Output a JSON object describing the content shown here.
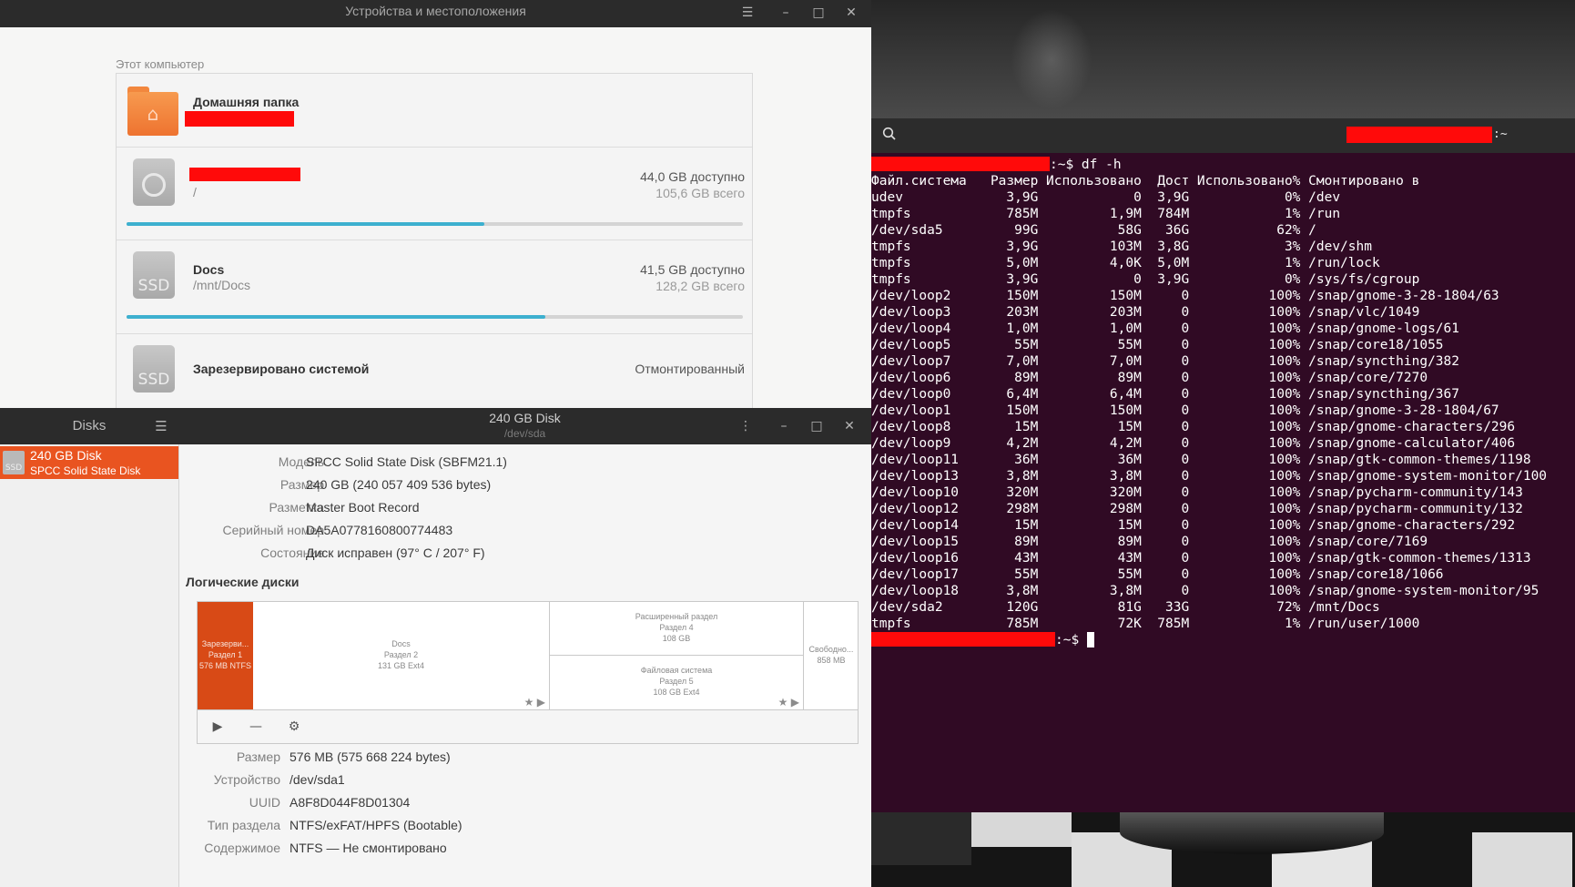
{
  "colors": {
    "accent": "#e95420",
    "usage_bar": "#3db0cf",
    "terminal_bg": "#300a24",
    "redaction": "#ff0a0a"
  },
  "files": {
    "title": "Устройства и местоположения",
    "menu_icon": "hamburger-icon",
    "section_label": "Этот компьютер",
    "places": [
      {
        "name": "Домашняя папка",
        "icon": "home-folder-icon"
      },
      {
        "path": "/",
        "available": "44,0 GB доступно",
        "total": "105,6 GB всего",
        "usage_fraction": 0.58,
        "icon": "disk-icon"
      },
      {
        "name": "Docs",
        "path": "/mnt/Docs",
        "available": "41,5 GB доступно",
        "total": "128,2 GB всего",
        "usage_fraction": 0.68,
        "icon": "ssd-icon",
        "icon_text": "SSD"
      },
      {
        "name": "Зарезервировано системой",
        "status": "Отмонтированный",
        "icon": "ssd-icon",
        "icon_text": "SSD"
      }
    ]
  },
  "disks": {
    "app_title": "Disks",
    "window_title": "240 GB Disk",
    "window_subtitle": "/dev/sda",
    "sidebar": {
      "disk_name": "240 GB Disk",
      "disk_model": "SPCC Solid State Disk",
      "icon_text": "SSD"
    },
    "drive_properties": [
      {
        "label": "Модель",
        "value": "SPCC Solid State Disk (SBFM21.1)"
      },
      {
        "label": "Размер",
        "value": "240 GB (240 057 409 536 bytes)"
      },
      {
        "label": "Разметка",
        "value": "Master Boot Record"
      },
      {
        "label": "Серийный номер",
        "value": "DA5A0778160800774483"
      },
      {
        "label": "Состояние",
        "value": "Диск исправен (97° C / 207° F)"
      }
    ],
    "volumes_heading": "Логические диски",
    "segments": {
      "reserved": [
        "Зарезерви...",
        "Раздел 1",
        "576 MB NTFS"
      ],
      "docs": [
        "Docs",
        "Раздел 2",
        "131 GB Ext4"
      ],
      "extended": [
        "Расширенный раздел",
        "Раздел 4",
        "108 GB"
      ],
      "fs": [
        "Файловая система",
        "Раздел 5",
        "108 GB Ext4"
      ],
      "free": [
        "Свободно...",
        "858 MB"
      ]
    },
    "volume_properties": [
      {
        "label": "Размер",
        "value": "576 MB (575 668 224 bytes)"
      },
      {
        "label": "Устройство",
        "value": "/dev/sda1"
      },
      {
        "label": "UUID",
        "value": "A8F8D044F8D01304"
      },
      {
        "label": "Тип раздела",
        "value": "NTFS/exFAT/HPFS (Bootable)"
      },
      {
        "label": "Содержимое",
        "value": "NTFS — Не смонтировано"
      }
    ]
  },
  "terminal": {
    "title_suffix": ":~",
    "prompt_suffix": ":~$ df -h",
    "final_prompt": ":~$ ",
    "header": "Файл.система   Размер Использовано  Дост Использовано% Cмонтировано в",
    "rows": [
      "udev             3,9G            0  3,9G            0% /dev",
      "tmpfs            785M         1,9M  784M            1% /run",
      "/dev/sda5         99G          58G   36G           62% /",
      "tmpfs            3,9G         103M  3,8G            3% /dev/shm",
      "tmpfs            5,0M         4,0K  5,0M            1% /run/lock",
      "tmpfs            3,9G            0  3,9G            0% /sys/fs/cgroup",
      "/dev/loop2       150M         150M     0          100% /snap/gnome-3-28-1804/63",
      "/dev/loop3       203M         203M     0          100% /snap/vlc/1049",
      "/dev/loop4       1,0M         1,0M     0          100% /snap/gnome-logs/61",
      "/dev/loop5        55M          55M     0          100% /snap/core18/1055",
      "/dev/loop7       7,0M         7,0M     0          100% /snap/syncthing/382",
      "/dev/loop6        89M          89M     0          100% /snap/core/7270",
      "/dev/loop0       6,4M         6,4M     0          100% /snap/syncthing/367",
      "/dev/loop1       150M         150M     0          100% /snap/gnome-3-28-1804/67",
      "/dev/loop8        15M          15M     0          100% /snap/gnome-characters/296",
      "/dev/loop9       4,2M         4,2M     0          100% /snap/gnome-calculator/406",
      "/dev/loop11       36M          36M     0          100% /snap/gtk-common-themes/1198",
      "/dev/loop13      3,8M         3,8M     0          100% /snap/gnome-system-monitor/100",
      "/dev/loop10      320M         320M     0          100% /snap/pycharm-community/143",
      "/dev/loop12      298M         298M     0          100% /snap/pycharm-community/132",
      "/dev/loop14       15M          15M     0          100% /snap/gnome-characters/292",
      "/dev/loop15       89M          89M     0          100% /snap/core/7169",
      "/dev/loop16       43M          43M     0          100% /snap/gtk-common-themes/1313",
      "/dev/loop17       55M          55M     0          100% /snap/core18/1066",
      "/dev/loop18      3,8M         3,8M     0          100% /snap/gnome-system-monitor/95",
      "/dev/sda2        120G          81G   33G           72% /mnt/Docs",
      "tmpfs            785M          72K  785M            1% /run/user/1000"
    ]
  }
}
